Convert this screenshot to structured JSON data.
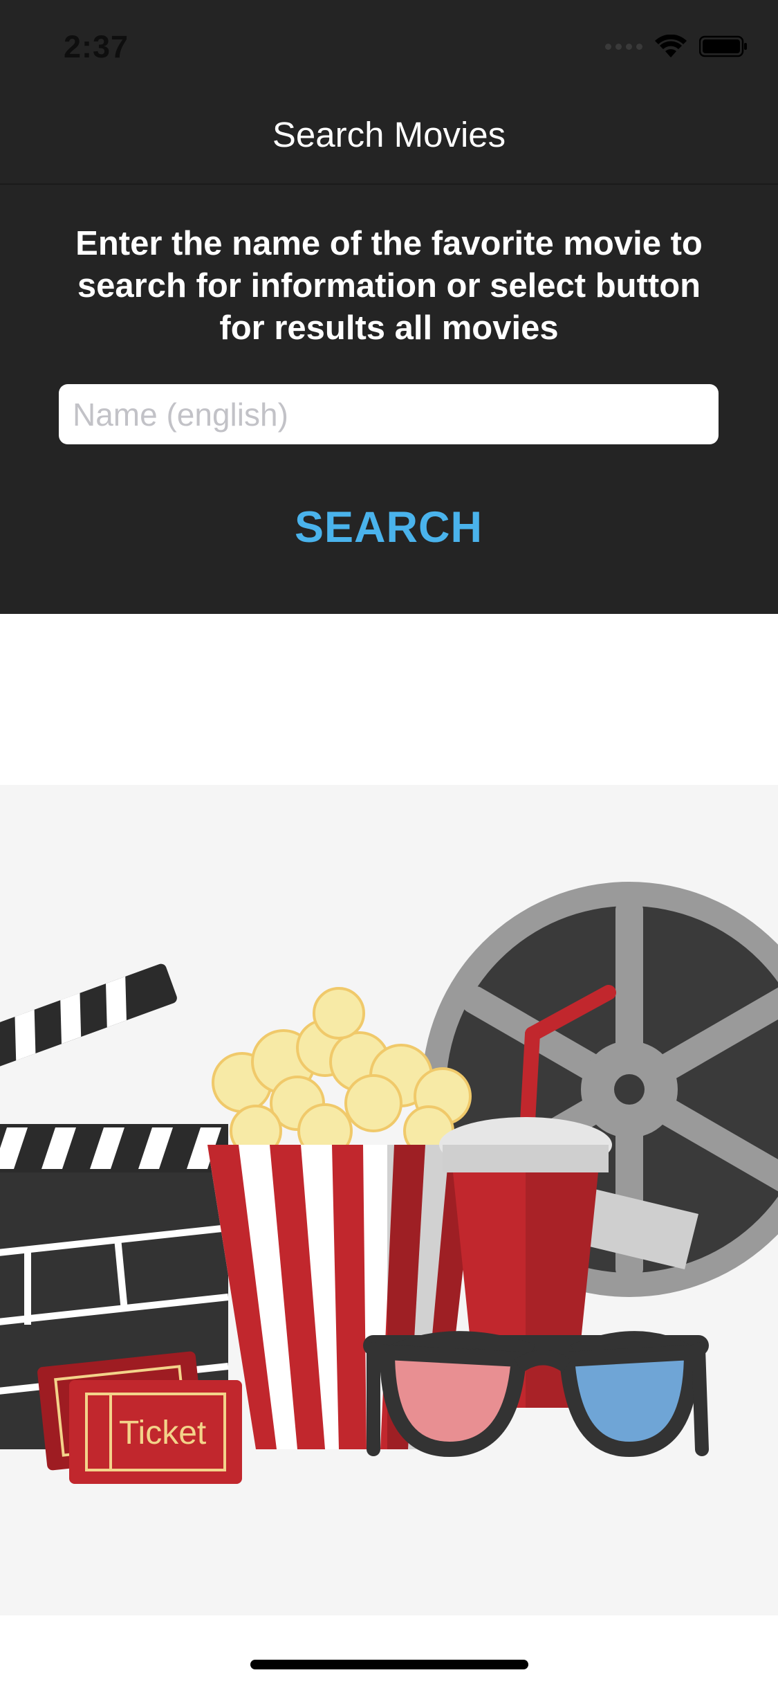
{
  "status_bar": {
    "time": "2:37"
  },
  "nav": {
    "title": "Search Movies"
  },
  "search": {
    "instructions": "Enter the name of the favorite movie to search for information or select button for results all movies",
    "input_placeholder": "Name (english)",
    "input_value": "",
    "button_label": "SEARCH"
  },
  "illustration": {
    "ticket_label": "Ticket",
    "icons": [
      "clapperboard-icon",
      "popcorn-icon",
      "soda-cup-icon",
      "film-reel-icon",
      "3d-glasses-icon",
      "ticket-icon"
    ]
  },
  "colors": {
    "bar_background": "#242424",
    "accent": "#4ab3ec",
    "illustration_background": "#f5f5f5"
  }
}
